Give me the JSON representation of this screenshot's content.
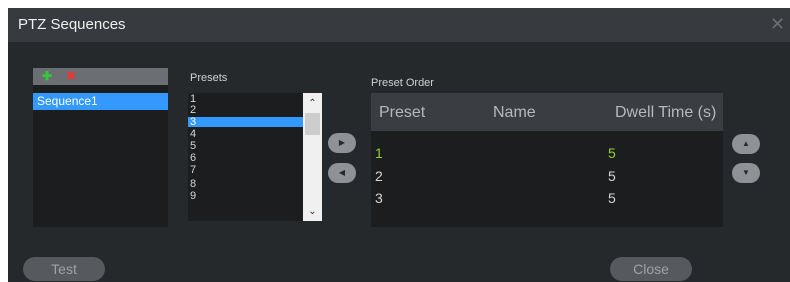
{
  "window": {
    "title": "PTZ Sequences",
    "close_glyph": "✕"
  },
  "sequences": {
    "toolbar": {
      "add_icon": "plus-icon",
      "remove_icon": "x-icon",
      "add_glyph": "✚",
      "remove_glyph": "✖",
      "add_color": "#35c93a",
      "remove_color": "#e23b3b"
    },
    "items": [
      "Sequence1"
    ]
  },
  "presets": {
    "label": "Presets",
    "items": [
      "1",
      "2",
      "3",
      "4",
      "5",
      "6",
      "7",
      "8",
      "9"
    ],
    "selected": "3",
    "scroll_up_glyph": "⌃",
    "scroll_down_glyph": "⌄"
  },
  "transfer": {
    "add_glyph": "▶",
    "remove_glyph": "◀"
  },
  "preset_order": {
    "label": "Preset Order",
    "columns": [
      "Preset",
      "Name",
      "Dwell Time (s)"
    ],
    "rows": [
      {
        "preset": "1",
        "name": "",
        "dwell": "5"
      },
      {
        "preset": "2",
        "name": "",
        "dwell": "5"
      },
      {
        "preset": "3",
        "name": "",
        "dwell": "5"
      }
    ],
    "highlight_color": "#9acd32",
    "move_up_glyph": "▲",
    "move_down_glyph": "▼"
  },
  "buttons": {
    "test": "Test",
    "close": "Close"
  }
}
